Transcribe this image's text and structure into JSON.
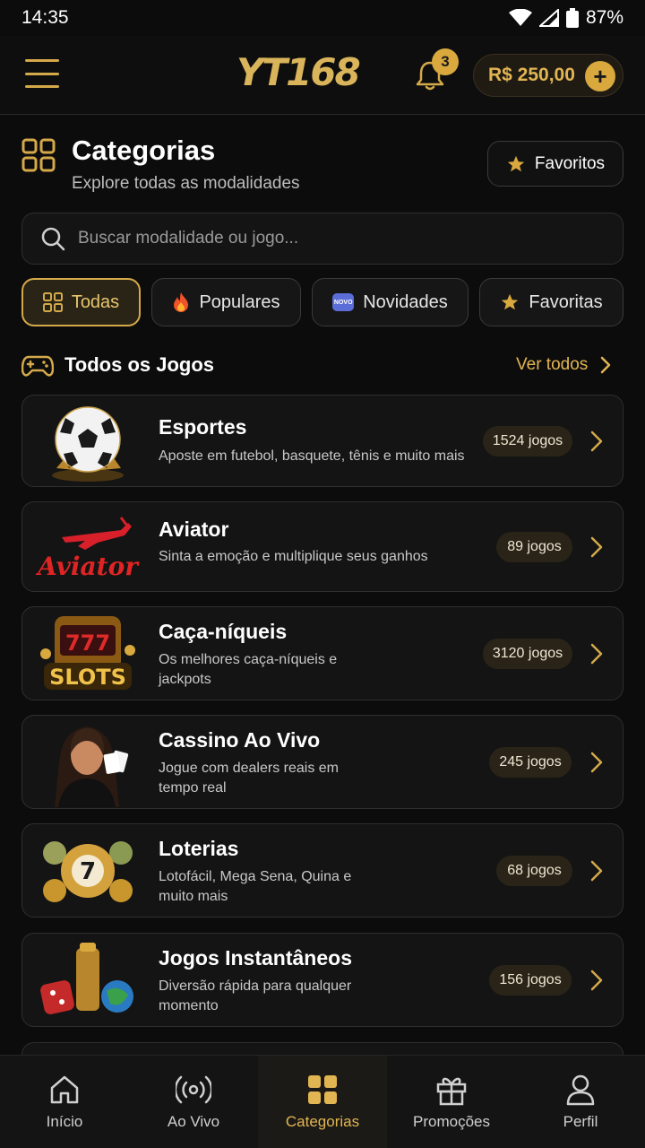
{
  "status": {
    "time": "14:35",
    "battery": "87%"
  },
  "header": {
    "logo": "YT168",
    "notifications": "3",
    "balance": "R$ 250,00"
  },
  "page": {
    "title": "Categorias",
    "subtitle": "Explore todas as modalidades",
    "favorites_label": "Favoritos"
  },
  "search": {
    "placeholder": "Buscar modalidade ou jogo..."
  },
  "filters": [
    {
      "label": "Todas",
      "active": true
    },
    {
      "label": "Populares",
      "active": false
    },
    {
      "label": "Novidades",
      "badge": "NOVO",
      "active": false
    },
    {
      "label": "Favoritas",
      "active": false
    }
  ],
  "section": {
    "title": "Todos os Jogos",
    "see_all": "Ver todos"
  },
  "categories": [
    {
      "name": "Esportes",
      "desc": "Aposte em futebol, basquete, tênis e muito mais",
      "count": "1524 jogos",
      "icon": "soccer-ball-icon"
    },
    {
      "name": "Aviator",
      "desc": "Sinta a emoção e multiplique seus ganhos",
      "count": "89 jogos",
      "icon": "aviator-logo",
      "logo_text": "Aviator"
    },
    {
      "name": "Caça-níqueis",
      "desc": "Os melhores caça-níqueis e jackpots",
      "count": "3120 jogos",
      "icon": "slot-machine-icon",
      "logo_text": "SLOTS",
      "reels": "777"
    },
    {
      "name": "Cassino Ao Vivo",
      "desc": "Jogue com dealers reais em tempo real",
      "count": "245 jogos",
      "icon": "live-dealer-icon"
    },
    {
      "name": "Loterias",
      "desc": "Lotofácil, Mega Sena, Quina e muito mais",
      "count": "68 jogos",
      "icon": "lottery-balls-icon",
      "ball_number": "7"
    },
    {
      "name": "Jogos Instantâneos",
      "desc": "Diversão rápida para qualquer momento",
      "count": "156 jogos",
      "icon": "dice-icon"
    }
  ],
  "nav": [
    {
      "label": "Início",
      "icon": "home-icon",
      "active": false
    },
    {
      "label": "Ao Vivo",
      "icon": "live-icon",
      "active": false
    },
    {
      "label": "Categorias",
      "icon": "grid-icon",
      "active": true
    },
    {
      "label": "Promoções",
      "icon": "gift-icon",
      "active": false
    },
    {
      "label": "Perfil",
      "icon": "user-icon",
      "active": false
    }
  ],
  "colors": {
    "accent": "#d9a93e",
    "background": "#0c0c0c",
    "card": "#141414"
  }
}
